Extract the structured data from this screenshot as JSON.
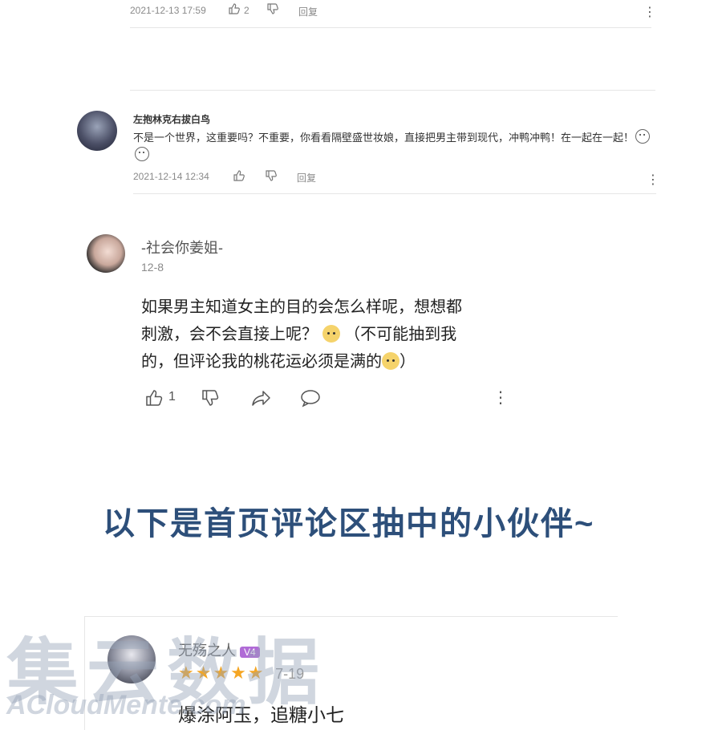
{
  "comment0": {
    "date": "2021-12-13 17:59",
    "likes": "2",
    "reply_label": "回复",
    "more_icon": "more-vertical-icon"
  },
  "comment1": {
    "name": "左抱林克右拔白鸟",
    "text": "不是一个世界，这重要吗？不重要，你看看隔壁盛世妆娘，直接把男主带到现代，冲鸭冲鸭！在一起在一起！",
    "date": "2021-12-14 12:34",
    "reply_label": "回复"
  },
  "comment2": {
    "name": "-社会你姜姐-",
    "date": "12-8",
    "line1": "如果男主知道女主的目的会怎么样呢，想想都",
    "line2a": "刺激，会不会直接上呢？",
    "line2b": "（不可能抽到我",
    "line3a": "的，但评论我的桃花运必须是满的",
    "line3b": "）",
    "likes": "1"
  },
  "banner": {
    "text": "以下是首页评论区抽中的小伙伴~"
  },
  "comment3": {
    "name": "无殇之人",
    "badge": "V4",
    "stars": "★★★★★",
    "date": "7-19",
    "text": "爆涂阿玉，追糖小七"
  },
  "watermark": {
    "cn": "集云数据",
    "en": "ACloudMente.com"
  },
  "colors": {
    "banner": "#2d4f7a",
    "star": "#f5a623",
    "badge": "#b06bd6"
  }
}
